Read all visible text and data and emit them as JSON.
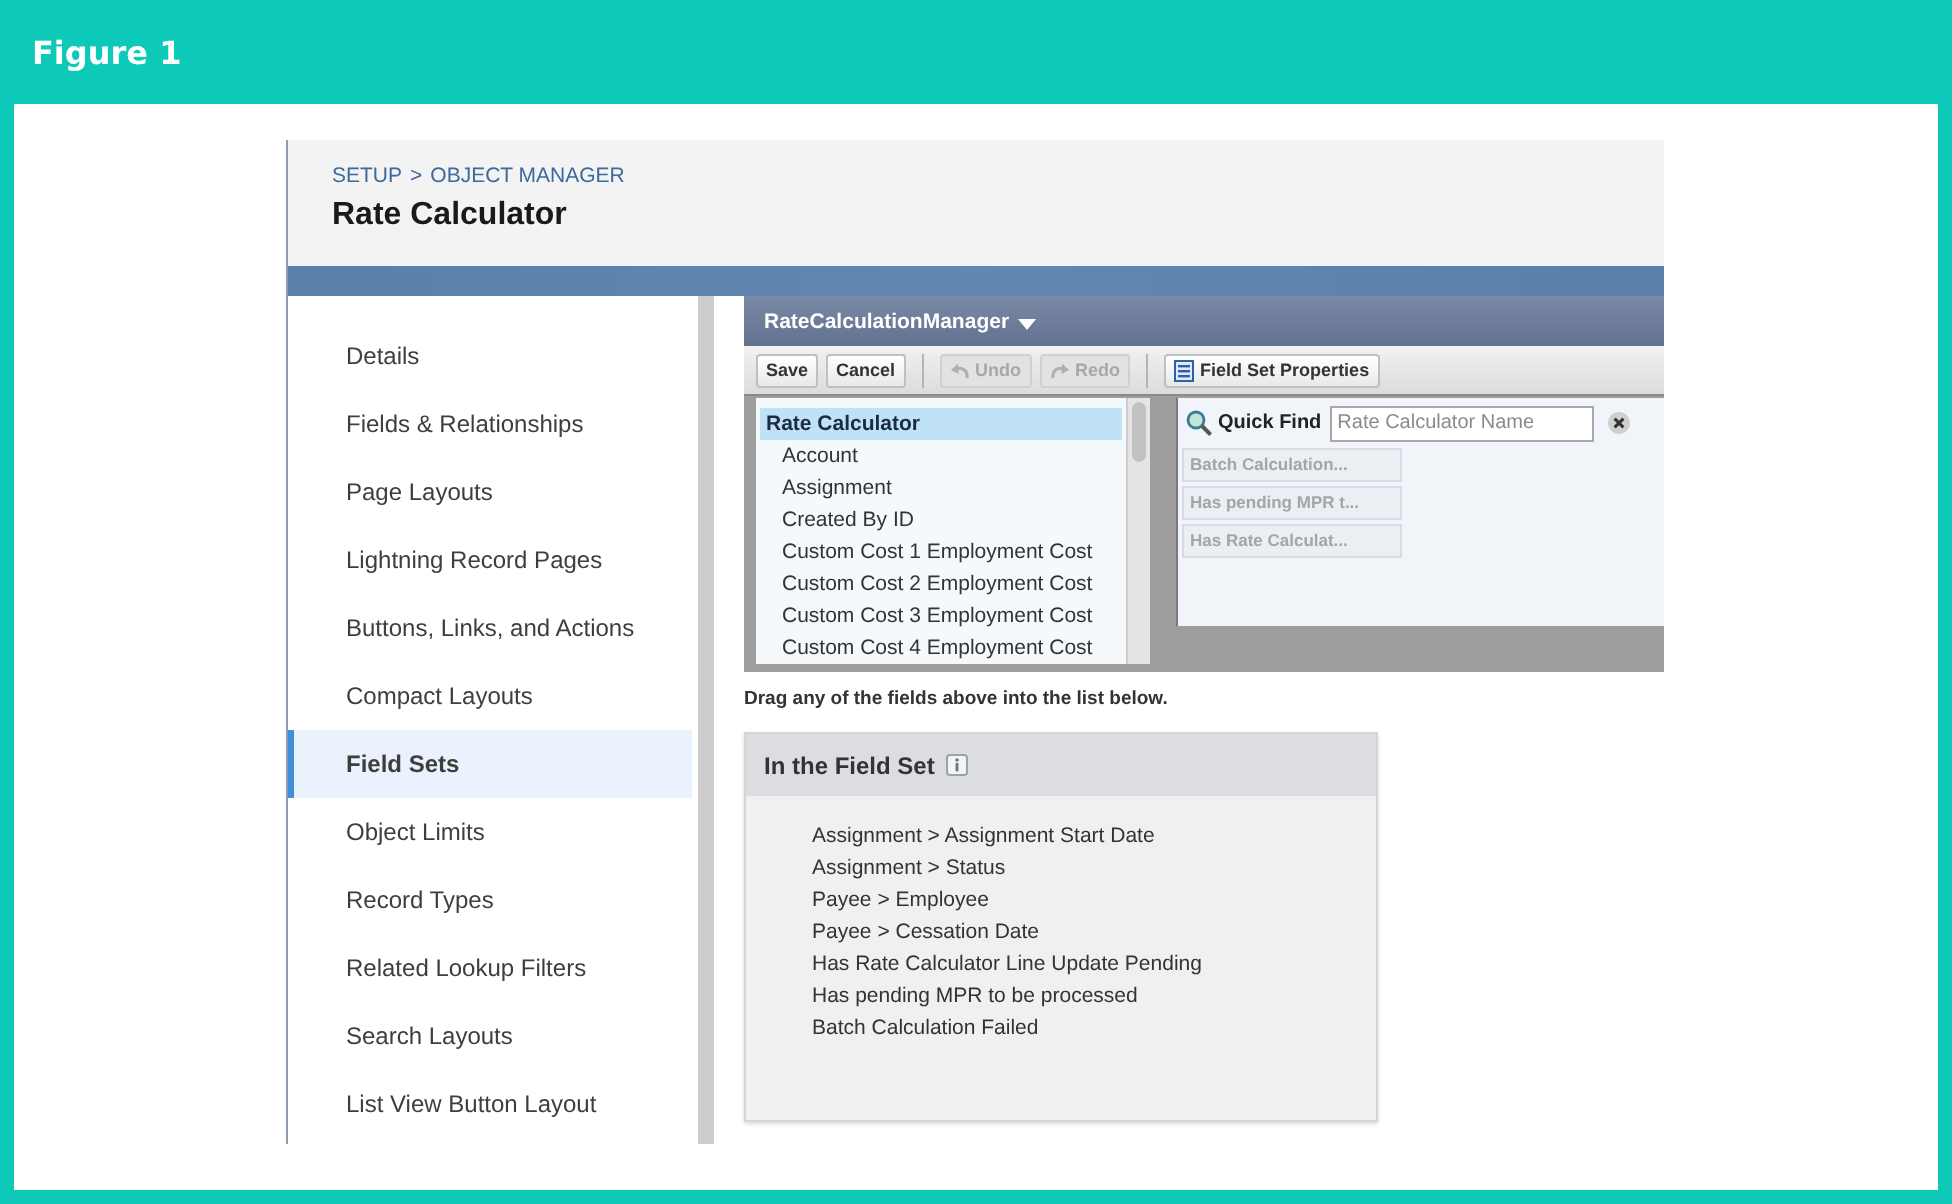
{
  "figure": {
    "title": "Figure 1"
  },
  "page_header": {
    "breadcrumb": {
      "items": [
        "SETUP",
        "OBJECT MANAGER"
      ],
      "separator": ">"
    },
    "title": "Rate Calculator"
  },
  "sidebar": {
    "items": [
      {
        "label": "Details",
        "selected": false
      },
      {
        "label": "Fields & Relationships",
        "selected": false
      },
      {
        "label": "Page Layouts",
        "selected": false
      },
      {
        "label": "Lightning Record Pages",
        "selected": false
      },
      {
        "label": "Buttons, Links, and Actions",
        "selected": false
      },
      {
        "label": "Compact Layouts",
        "selected": false
      },
      {
        "label": "Field Sets",
        "selected": true
      },
      {
        "label": "Object Limits",
        "selected": false
      },
      {
        "label": "Record Types",
        "selected": false
      },
      {
        "label": "Related Lookup Filters",
        "selected": false
      },
      {
        "label": "Search Layouts",
        "selected": false
      },
      {
        "label": "List View Button Layout",
        "selected": false
      }
    ]
  },
  "editor": {
    "title": "RateCalculationManager",
    "toolbar": [
      {
        "buttons": [
          {
            "kind": "text",
            "label": "Save",
            "disabled": false
          },
          {
            "kind": "text",
            "label": "Cancel",
            "disabled": false
          }
        ]
      },
      {
        "buttons": [
          {
            "kind": "undo",
            "label": "Undo",
            "disabled": true
          },
          {
            "kind": "redo",
            "label": "Redo",
            "disabled": true
          }
        ]
      },
      {
        "buttons": [
          {
            "kind": "properties",
            "label": "Field Set Properties",
            "disabled": false
          }
        ]
      }
    ],
    "tree": {
      "label": "Rate Calculator",
      "selected": true,
      "children": [
        {
          "label": "Account",
          "selected": false
        },
        {
          "label": "Assignment",
          "selected": false
        },
        {
          "label": "Created By ID",
          "selected": false
        },
        {
          "label": "Custom Cost 1 Employment Cost",
          "selected": false
        },
        {
          "label": "Custom Cost 2 Employment Cost",
          "selected": false
        },
        {
          "label": "Custom Cost 3 Employment Cost",
          "selected": false
        },
        {
          "label": "Custom Cost 4 Employment Cost",
          "selected": false
        }
      ]
    },
    "quick_find": {
      "label": "Quick Find",
      "placeholder": "Rate Calculator Name"
    },
    "fields": [
      {
        "label": "Batch Calculation...",
        "disabled": true
      },
      {
        "label": "Has pending MPR t...",
        "disabled": true
      },
      {
        "label": "Has Rate Calculat...",
        "disabled": true
      }
    ]
  },
  "instruction": "Drag any of the fields above into the list below.",
  "field_set": {
    "title": "In the Field Set",
    "items": [
      "Assignment > Assignment Start Date",
      "Assignment > Status",
      "Payee > Employee",
      "Payee > Cessation Date",
      "Has Rate Calculator Line Update Pending",
      "Has pending MPR to be processed",
      "Batch Calculation Failed"
    ]
  }
}
